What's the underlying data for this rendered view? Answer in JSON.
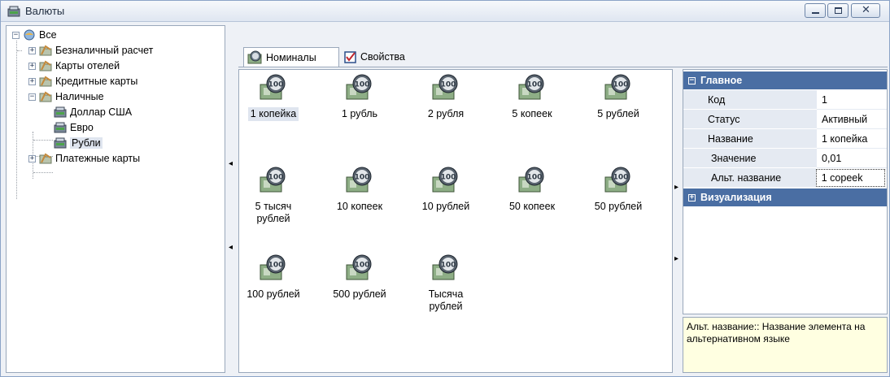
{
  "window": {
    "title": "Валюты",
    "icon": "currency-register-icon",
    "controls": [
      "minimize",
      "maximize",
      "close"
    ]
  },
  "tree": {
    "root": "Все",
    "items": [
      {
        "label": "Безналичный расчет",
        "expanded": false
      },
      {
        "label": "Карты отелей",
        "expanded": false
      },
      {
        "label": "Кредитные карты",
        "expanded": false
      },
      {
        "label": "Наличные",
        "expanded": true
      },
      {
        "label": "Доллар США",
        "child": true
      },
      {
        "label": "Евро",
        "child": true
      },
      {
        "label": "Рубли",
        "child": true,
        "selected": true
      },
      {
        "label": "Платежные карты",
        "expanded": false
      }
    ]
  },
  "tabs": [
    {
      "label": "Номиналы",
      "active": true,
      "icon": "coin-icon"
    },
    {
      "label": "Свойства",
      "active": false,
      "icon": "checkbox-icon"
    }
  ],
  "denominations": [
    {
      "label": "1 копейка",
      "selected": true
    },
    {
      "label": "1 рубль"
    },
    {
      "label": "2 рубля"
    },
    {
      "label": "5 копеек"
    },
    {
      "label": "5 рублей"
    },
    {
      "label": "5 тысяч рублей"
    },
    {
      "label": "10 копеек"
    },
    {
      "label": "10 рублей"
    },
    {
      "label": "50 копеек"
    },
    {
      "label": "50 рублей"
    },
    {
      "label": "100 рублей"
    },
    {
      "label": "500 рублей"
    },
    {
      "label": "Тысяча рублей"
    }
  ],
  "coin_badge": "100",
  "properties": {
    "category_main": "Главное",
    "category_visual": "Визуализация",
    "rows": [
      {
        "name": "Код",
        "value": "1"
      },
      {
        "name": "Статус",
        "value": "Активный"
      },
      {
        "name": "Название",
        "value": "1 копейка"
      },
      {
        "name": "Значение",
        "value": "0,01"
      },
      {
        "name": "Альт. название",
        "value": "1 copeek"
      }
    ]
  },
  "description": "Альт. название:: Название элемента на альтернативном языке",
  "colors": {
    "category_header": "#4a6ea3",
    "selection": "#dfe5ef",
    "description_bg": "#ffffe1"
  }
}
